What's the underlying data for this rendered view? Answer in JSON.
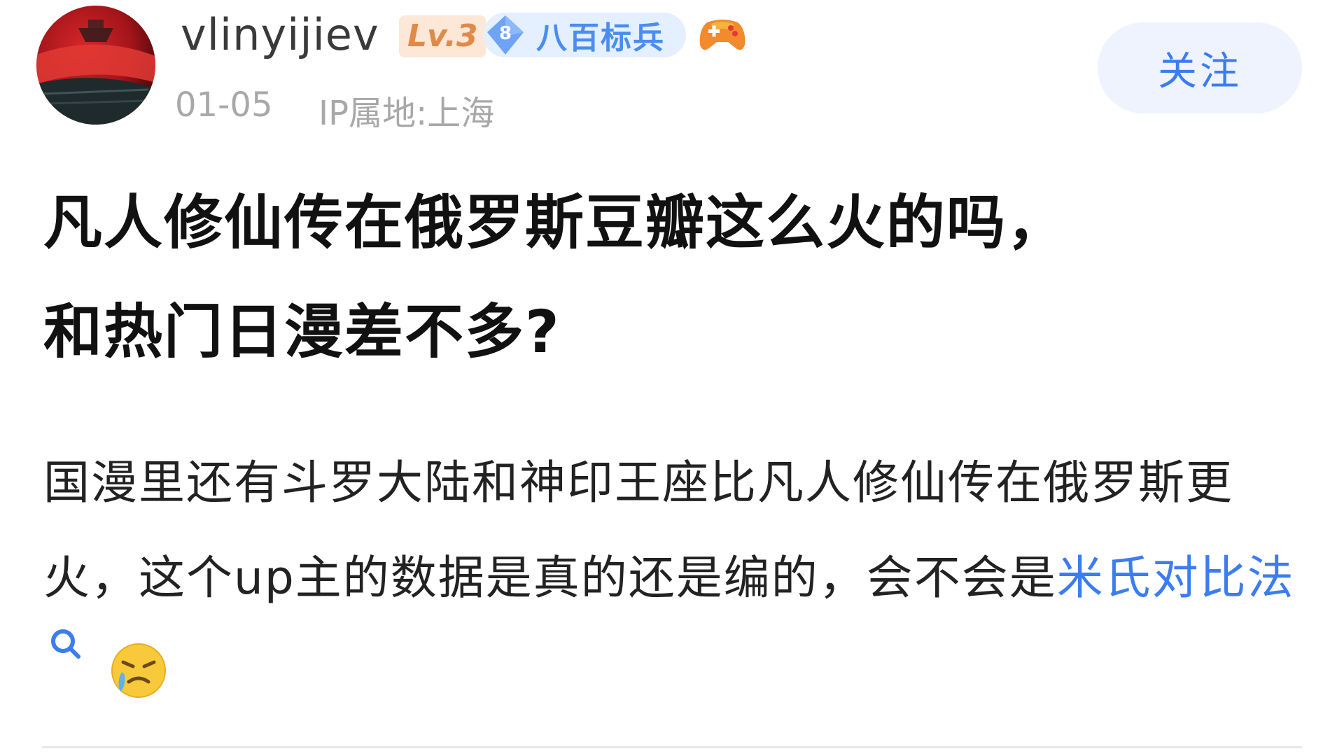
{
  "author": {
    "username": "vlinyijiev",
    "level": "Lv.3",
    "rank_number": "8",
    "rank_title": "八百标兵",
    "post_date": "01-05",
    "ip_location": "IP属地:上海"
  },
  "actions": {
    "follow_label": "关注"
  },
  "post": {
    "title_line1": "凡人修仙传在俄罗斯豆瓣这么火的吗，",
    "title_line2": "和热门日漫差不多?",
    "body_text": "国漫里还有斗罗大陆和神印王座比凡人修仙传在俄罗斯更火，这个up主的数据是真的还是编的，会不会是",
    "body_link": "米氏对比法"
  },
  "colors": {
    "accent_blue": "#3b7df0",
    "follow_bg": "#eef3fd",
    "level_bg": "#fde7d6",
    "level_fg": "#e08a4a",
    "meta_gray": "#a8a8a8"
  },
  "icons": {
    "link_search": "search-icon",
    "emoji": "crying-emoji-icon",
    "game": "gamepad-icon",
    "rank": "gem-badge-icon"
  }
}
